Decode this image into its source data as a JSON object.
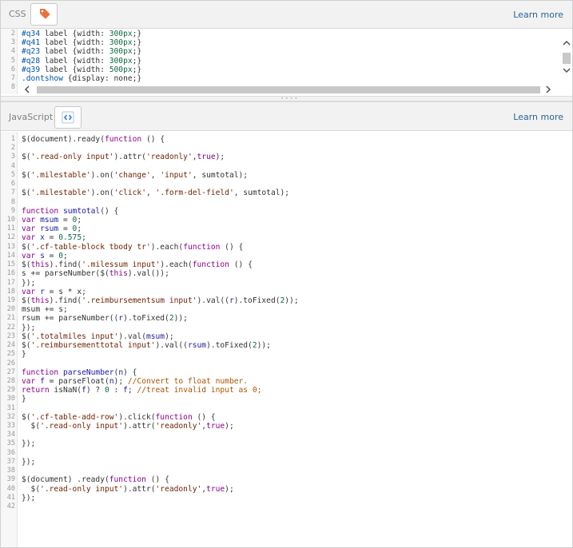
{
  "css_panel": {
    "title": "CSS",
    "learn_more": "Learn more",
    "icon": "tag-icon",
    "icon_color": "#e8743b",
    "first_line_number": 2,
    "lines": [
      [
        [
          "#q34",
          "sel"
        ],
        [
          " label {width: ",
          "plain"
        ],
        [
          "300px",
          "num"
        ],
        [
          ";}",
          "plain"
        ]
      ],
      [
        [
          "#q41",
          "sel"
        ],
        [
          " label {width: ",
          "plain"
        ],
        [
          "300px",
          "num"
        ],
        [
          ";}",
          "plain"
        ]
      ],
      [
        [
          "#q23",
          "sel"
        ],
        [
          " label {width: ",
          "plain"
        ],
        [
          "300px",
          "num"
        ],
        [
          ";}",
          "plain"
        ]
      ],
      [
        [
          "#q28",
          "sel"
        ],
        [
          " label {width: ",
          "plain"
        ],
        [
          "300px",
          "num"
        ],
        [
          ";}",
          "plain"
        ]
      ],
      [
        [
          "#q39",
          "sel"
        ],
        [
          " label {width: ",
          "plain"
        ],
        [
          "500px",
          "num"
        ],
        [
          ";}",
          "plain"
        ]
      ],
      [
        [
          ".dontshow",
          "sel"
        ],
        [
          " {display: none;}",
          "plain"
        ]
      ],
      [
        [
          "",
          "plain"
        ]
      ]
    ]
  },
  "js_panel": {
    "title": "JavaScript",
    "learn_more": "Learn more",
    "icon": "code-brackets-icon",
    "icon_color": "#3a7bd5",
    "lines": [
      [
        [
          "$(document).ready(",
          "plain"
        ],
        [
          "function",
          "kw"
        ],
        [
          " () {",
          "plain"
        ]
      ],
      [
        [
          "",
          "plain"
        ]
      ],
      [
        [
          "$(",
          "plain"
        ],
        [
          "'.read-only input'",
          "str"
        ],
        [
          ").attr(",
          "plain"
        ],
        [
          "'readonly'",
          "str"
        ],
        [
          ",",
          "plain"
        ],
        [
          "true",
          "kw"
        ],
        [
          ");",
          "plain"
        ]
      ],
      [
        [
          "",
          "plain"
        ]
      ],
      [
        [
          "$(",
          "plain"
        ],
        [
          "'.milestable'",
          "str"
        ],
        [
          ").on(",
          "plain"
        ],
        [
          "'change'",
          "str"
        ],
        [
          ", ",
          "plain"
        ],
        [
          "'input'",
          "str"
        ],
        [
          ", sumtotal);",
          "plain"
        ]
      ],
      [
        [
          "",
          "plain"
        ]
      ],
      [
        [
          "$(",
          "plain"
        ],
        [
          "'.milestable'",
          "str"
        ],
        [
          ").on(",
          "plain"
        ],
        [
          "'click'",
          "str"
        ],
        [
          ", ",
          "plain"
        ],
        [
          "'.form-del-field'",
          "str"
        ],
        [
          ", sumtotal);",
          "plain"
        ]
      ],
      [
        [
          "",
          "plain"
        ]
      ],
      [
        [
          "function",
          "kw"
        ],
        [
          " ",
          "plain"
        ],
        [
          "sumtotal",
          "var"
        ],
        [
          "() {",
          "plain"
        ]
      ],
      [
        [
          "var",
          "kw"
        ],
        [
          " ",
          "plain"
        ],
        [
          "msum",
          "var"
        ],
        [
          " = ",
          "plain"
        ],
        [
          "0",
          "num"
        ],
        [
          ";",
          "plain"
        ]
      ],
      [
        [
          "var",
          "kw"
        ],
        [
          " ",
          "plain"
        ],
        [
          "rsum",
          "var"
        ],
        [
          " = ",
          "plain"
        ],
        [
          "0",
          "num"
        ],
        [
          ";",
          "plain"
        ]
      ],
      [
        [
          "var",
          "kw"
        ],
        [
          " ",
          "plain"
        ],
        [
          "x",
          "var"
        ],
        [
          " = ",
          "plain"
        ],
        [
          "0.575",
          "num"
        ],
        [
          ";",
          "plain"
        ]
      ],
      [
        [
          "$(",
          "plain"
        ],
        [
          "'.cf-table-block tbody tr'",
          "str"
        ],
        [
          ").each(",
          "plain"
        ],
        [
          "function",
          "kw"
        ],
        [
          " () {",
          "plain"
        ]
      ],
      [
        [
          "var",
          "kw"
        ],
        [
          " ",
          "plain"
        ],
        [
          "s",
          "var"
        ],
        [
          " = ",
          "plain"
        ],
        [
          "0",
          "num"
        ],
        [
          ";",
          "plain"
        ]
      ],
      [
        [
          "$(",
          "plain"
        ],
        [
          "this",
          "kw"
        ],
        [
          ").find(",
          "plain"
        ],
        [
          "'.milessum input'",
          "str"
        ],
        [
          ").each(",
          "plain"
        ],
        [
          "function",
          "kw"
        ],
        [
          " () {",
          "plain"
        ]
      ],
      [
        [
          "s += parseNumber($(",
          "plain"
        ],
        [
          "this",
          "kw"
        ],
        [
          ").val());",
          "plain"
        ]
      ],
      [
        [
          "});",
          "plain"
        ]
      ],
      [
        [
          "var",
          "kw"
        ],
        [
          " ",
          "plain"
        ],
        [
          "r",
          "var"
        ],
        [
          " = s * x;",
          "plain"
        ]
      ],
      [
        [
          "$(",
          "plain"
        ],
        [
          "this",
          "kw"
        ],
        [
          ").find(",
          "plain"
        ],
        [
          "'.reimbursementsum input'",
          "str"
        ],
        [
          ").val((",
          "plain"
        ],
        [
          "r",
          "var"
        ],
        [
          ").toFixed(",
          "plain"
        ],
        [
          "2",
          "num"
        ],
        [
          "));",
          "plain"
        ]
      ],
      [
        [
          "msum += s;",
          "plain"
        ]
      ],
      [
        [
          "rsum += parseNumber((",
          "plain"
        ],
        [
          "r",
          "var"
        ],
        [
          ").toFixed(",
          "plain"
        ],
        [
          "2",
          "num"
        ],
        [
          "));",
          "plain"
        ]
      ],
      [
        [
          "});",
          "plain"
        ]
      ],
      [
        [
          "$(",
          "plain"
        ],
        [
          "'.totalmiles input'",
          "str"
        ],
        [
          ").val(",
          "plain"
        ],
        [
          "msum",
          "var"
        ],
        [
          ");",
          "plain"
        ]
      ],
      [
        [
          "$(",
          "plain"
        ],
        [
          "'.reimbursementtotal input'",
          "str"
        ],
        [
          ").val((",
          "plain"
        ],
        [
          "rsum",
          "var"
        ],
        [
          ").toFixed(",
          "plain"
        ],
        [
          "2",
          "num"
        ],
        [
          "));",
          "plain"
        ]
      ],
      [
        [
          "}",
          "plain"
        ]
      ],
      [
        [
          "",
          "plain"
        ]
      ],
      [
        [
          "function",
          "kw"
        ],
        [
          " ",
          "plain"
        ],
        [
          "parseNumber",
          "var"
        ],
        [
          "(",
          "plain"
        ],
        [
          "n",
          "var"
        ],
        [
          ") {",
          "plain"
        ]
      ],
      [
        [
          "var",
          "kw"
        ],
        [
          " ",
          "plain"
        ],
        [
          "f",
          "var"
        ],
        [
          " = parseFloat(",
          "plain"
        ],
        [
          "n",
          "var"
        ],
        [
          "); ",
          "plain"
        ],
        [
          "//Convert to float number.",
          "com"
        ]
      ],
      [
        [
          "return",
          "kw"
        ],
        [
          " isNaN(",
          "plain"
        ],
        [
          "f",
          "var"
        ],
        [
          ") ? ",
          "plain"
        ],
        [
          "0",
          "num"
        ],
        [
          " : ",
          "plain"
        ],
        [
          "f",
          "var"
        ],
        [
          "; ",
          "plain"
        ],
        [
          "//treat invalid input as 0;",
          "com"
        ]
      ],
      [
        [
          "}",
          "plain"
        ]
      ],
      [
        [
          "",
          "plain"
        ]
      ],
      [
        [
          "$(",
          "plain"
        ],
        [
          "'.cf-table-add-row'",
          "str"
        ],
        [
          ").click(",
          "plain"
        ],
        [
          "function",
          "kw"
        ],
        [
          " () {",
          "plain"
        ]
      ],
      [
        [
          "  $(",
          "plain"
        ],
        [
          "'.read-only input'",
          "str"
        ],
        [
          ").attr(",
          "plain"
        ],
        [
          "'readonly'",
          "str"
        ],
        [
          ",",
          "plain"
        ],
        [
          "true",
          "kw"
        ],
        [
          ");",
          "plain"
        ]
      ],
      [
        [
          "",
          "plain"
        ]
      ],
      [
        [
          "});",
          "plain"
        ]
      ],
      [
        [
          "",
          "plain"
        ]
      ],
      [
        [
          "});",
          "plain"
        ]
      ],
      [
        [
          "",
          "plain"
        ]
      ],
      [
        [
          "$(document) .ready(",
          "plain"
        ],
        [
          "function",
          "kw"
        ],
        [
          " () {",
          "plain"
        ]
      ],
      [
        [
          "  $(",
          "plain"
        ],
        [
          "'.read-only input'",
          "str"
        ],
        [
          ").attr(",
          "plain"
        ],
        [
          "'readonly'",
          "str"
        ],
        [
          ",",
          "plain"
        ],
        [
          "true",
          "kw"
        ],
        [
          ");",
          "plain"
        ]
      ],
      [
        [
          "});",
          "plain"
        ]
      ],
      [
        [
          "",
          "plain"
        ]
      ]
    ]
  }
}
